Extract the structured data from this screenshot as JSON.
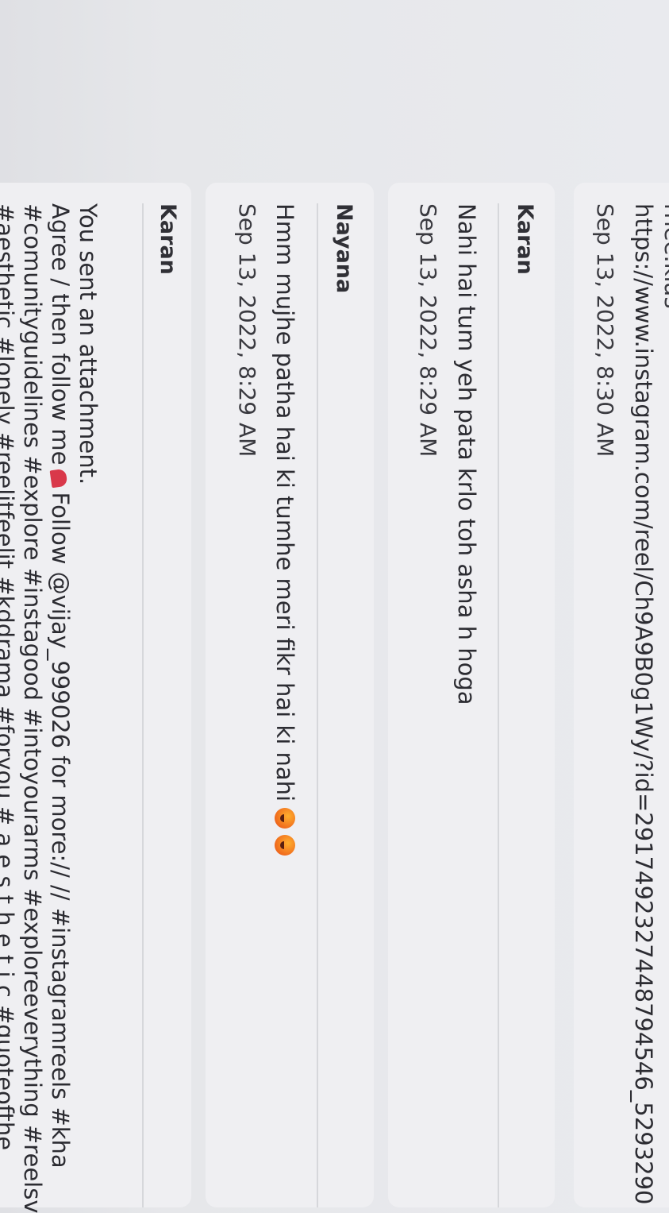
{
  "messages": [
    {
      "partial_top": "rnee.kias",
      "body": "https://www.instagram.com/reel/Ch9A9B0g1Wy/?id=2917492327448794546_5293290",
      "time": "Sep 13, 2022, 8:30 AM"
    },
    {
      "sender": "Karan",
      "body": "Nahi hai tum yeh pata krlo toh asha h hoga",
      "time": "Sep 13, 2022, 8:29 AM"
    },
    {
      "sender": "Nayana",
      "body": "Hmm mujhe patha hai ki tumhe meri fikr hai ki nahi",
      "emojis": [
        "face-emoji",
        "face-emoji"
      ],
      "time": "Sep 13, 2022, 8:29 AM"
    },
    {
      "sender": "Karan",
      "line1": "You sent an attachment.",
      "line2_a": "Agree / then follow me",
      "line2_b": "Follow @vijay_999026 for more:// // #instagramreels #kha",
      "line3": "#comunityguidelines #explore #instagood #intoyourarms #exploreeverything #reelsv",
      "line4": "#aesthetic #lonely #reelitfeelit #kddrama #foryou # a e s t h e t i c #quoteofthe"
    }
  ],
  "colors": {
    "background": "#e6e7ea",
    "card": "#efeff2",
    "divider": "#d6d7db",
    "text": "#2c2c32"
  }
}
